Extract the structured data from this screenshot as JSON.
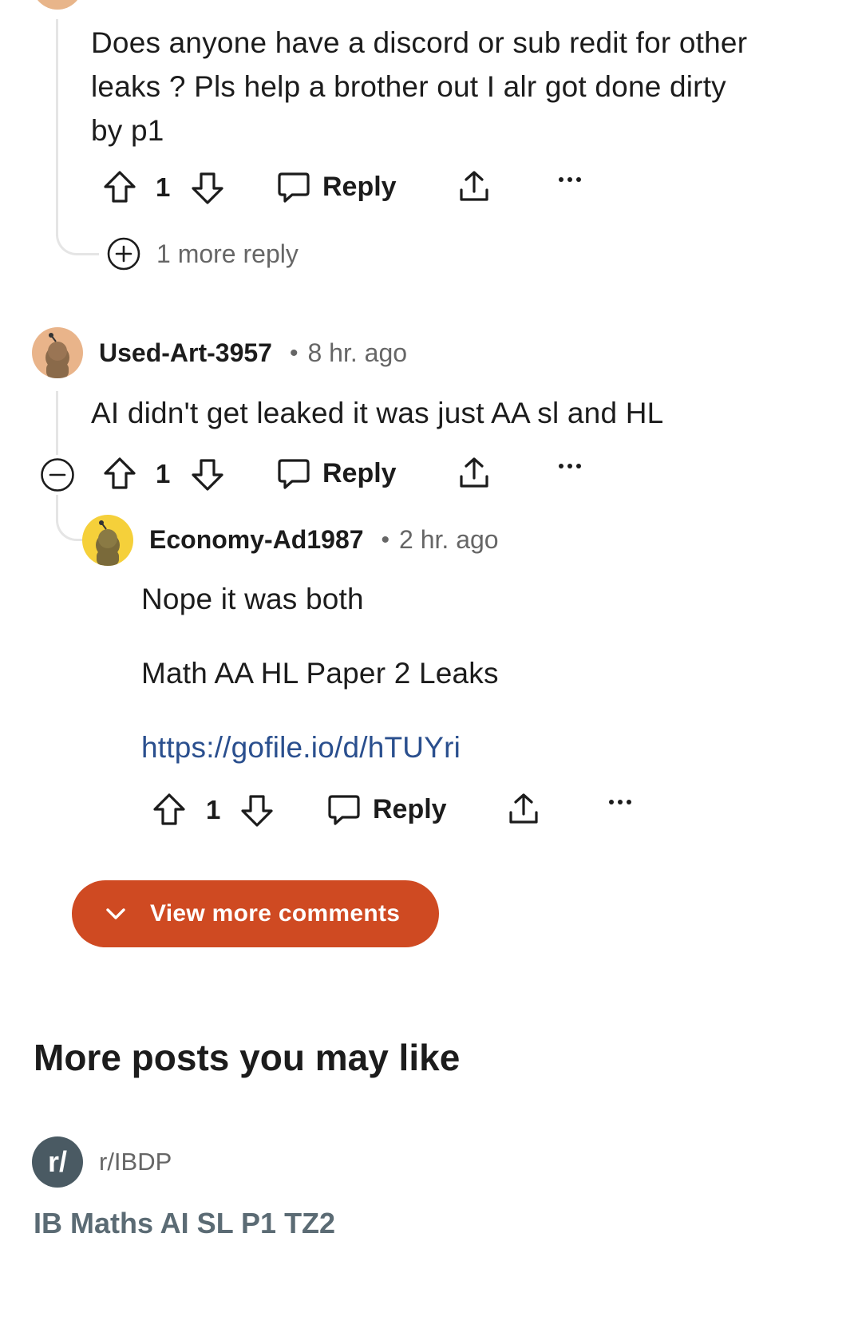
{
  "comment_top": {
    "lines": [
      "Does anyone have a discord or sub redit for other",
      "leaks ? Pls help a brother out I alr got done dirty",
      "by p1"
    ],
    "votes": "1",
    "reply_label": "Reply",
    "more_label": "•••"
  },
  "more_replies": {
    "label": "1 more reply"
  },
  "comment_used_art": {
    "author": "Used-Art-3957",
    "separator": "•",
    "time": "8 hr. ago",
    "text": "AI didn't get leaked it was just AA sl and HL",
    "votes": "1",
    "reply_label": "Reply",
    "more_label": "•••"
  },
  "comment_economy": {
    "author": "Economy-Ad1987",
    "separator": "•",
    "time": "2 hr. ago",
    "text_line1": "Nope it was both",
    "text_line2": "Math AA HL Paper 2 Leaks",
    "link": "https://gofile.io/d/hTUYri",
    "votes": "1",
    "reply_label": "Reply",
    "more_label": "•••"
  },
  "view_more": {
    "label": "View more comments"
  },
  "more_posts": {
    "title": "More posts you may like",
    "subreddit_icon": "r/",
    "subreddit": "r/IBDP",
    "post_title": "IB Maths AI SL P1 TZ2"
  },
  "colors": {
    "accent": "#cf4a22",
    "link": "#2a4f8e",
    "muted": "#666666",
    "thread": "#e5e5e5"
  },
  "icons": [
    "upvote-icon",
    "downvote-icon",
    "reply-bubble-icon",
    "share-icon",
    "more-dots-icon",
    "expand-plus-icon",
    "collapse-minus-icon",
    "chevron-down-icon"
  ]
}
